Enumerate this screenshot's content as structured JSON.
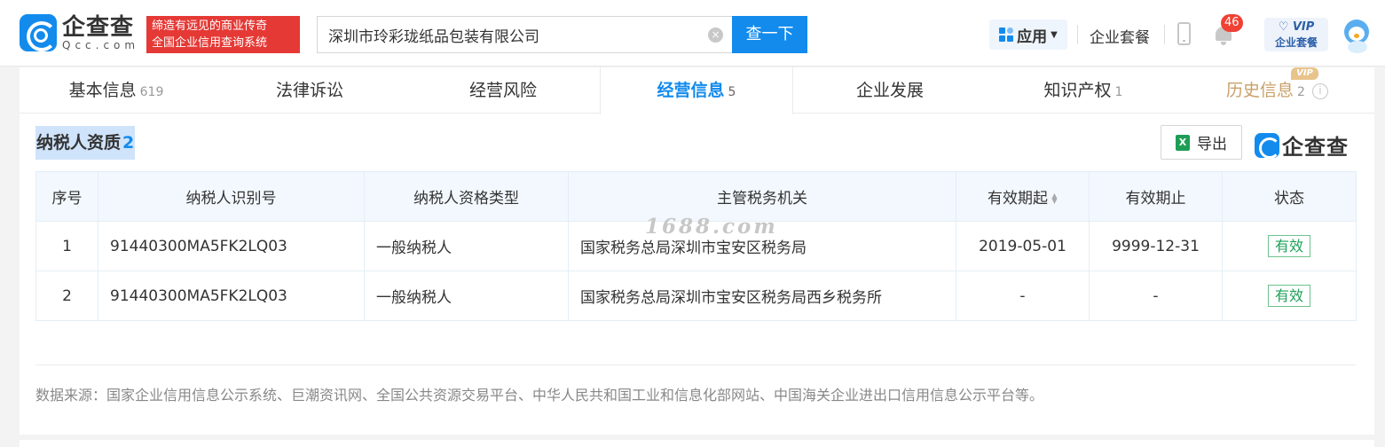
{
  "header": {
    "logo_cn": "企查查",
    "logo_en": "Qcc.com",
    "slogan_line1": "缔造有远见的商业传奇",
    "slogan_line2": "全国企业信用查询系统",
    "search_value": "深圳市玲彩珑纸品包装有限公司",
    "search_button": "查一下",
    "apps_label": "应用",
    "enterprise_package": "企业套餐",
    "notification_count": "46",
    "vip_line1": "VIP",
    "vip_line2": "企业套餐"
  },
  "tabs": [
    {
      "label": "基本信息",
      "count": "619"
    },
    {
      "label": "法律诉讼",
      "count": ""
    },
    {
      "label": "经营风险",
      "count": ""
    },
    {
      "label": "经营信息",
      "count": "5",
      "active": true
    },
    {
      "label": "企业发展",
      "count": ""
    },
    {
      "label": "知识产权",
      "count": "1"
    },
    {
      "label": "历史信息",
      "count": "2",
      "vip": "VIP"
    }
  ],
  "section": {
    "title": "纳税人资质",
    "count": "2",
    "export_label": "导出",
    "brand": "企查查"
  },
  "table": {
    "headers": [
      "序号",
      "纳税人识别号",
      "纳税人资格类型",
      "主管税务机关",
      "有效期起",
      "有效期止",
      "状态"
    ],
    "rows": [
      [
        "1",
        "91440300MA5FK2LQ03",
        "一般纳税人",
        "国家税务总局深圳市宝安区税务局",
        "2019-05-01",
        "9999-12-31",
        "有效"
      ],
      [
        "2",
        "91440300MA5FK2LQ03",
        "一般纳税人",
        "国家税务总局深圳市宝安区税务局西乡税务所",
        "-",
        "-",
        "有效"
      ]
    ]
  },
  "watermark": "1688.com",
  "source_note": "数据来源：国家企业信用信息公示系统、巨潮资讯网、全国公共资源交易平台、中华人民共和国工业和信息化部网站、中国海关企业进出口信用信息公示平台等。",
  "colors": {
    "brand_blue": "#128bed",
    "slogan_red": "#e53935",
    "status_green": "#1ea05a",
    "vip_gold": "#c9a068"
  }
}
